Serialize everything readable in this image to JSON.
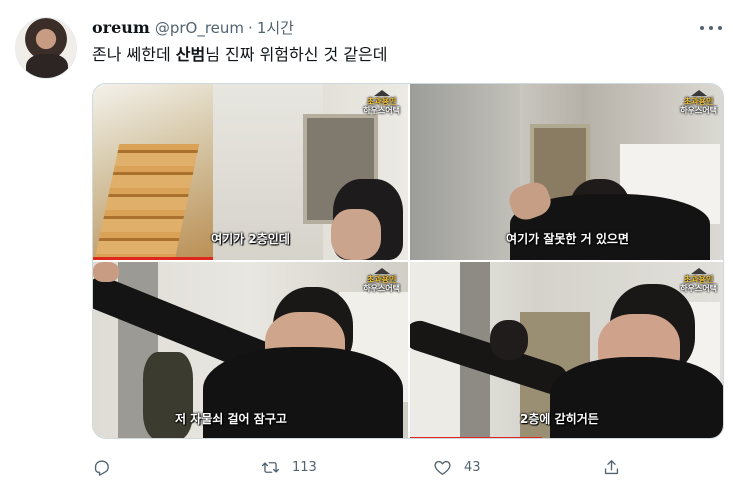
{
  "tweet": {
    "display_name": "oreum",
    "handle": "@prO_reum",
    "separator": "·",
    "time": "1시간",
    "text_before": "존나 쎄한데 ",
    "text_bold": "산범",
    "text_after": "님 진짜 위험하신 것 같은데"
  },
  "media": {
    "watermark_line1": "초과용인",
    "watermark_line2": "하우스어택",
    "panels": [
      {
        "caption": "여기가 2층인데",
        "progress": 0.38
      },
      {
        "caption": "여기가 잘못한 거 있으면",
        "progress": 0.0
      },
      {
        "caption": "저 자물쇠 걸어 잠구고",
        "progress": 0.0
      },
      {
        "caption": "2층에 갇히거든",
        "progress": 0.42
      }
    ]
  },
  "actions": {
    "reply_count": "",
    "retweet_count": "113",
    "like_count": "43"
  },
  "colors": {
    "text_secondary": "#536471",
    "border": "#cfd9de",
    "progress_red": "#e0271d"
  }
}
